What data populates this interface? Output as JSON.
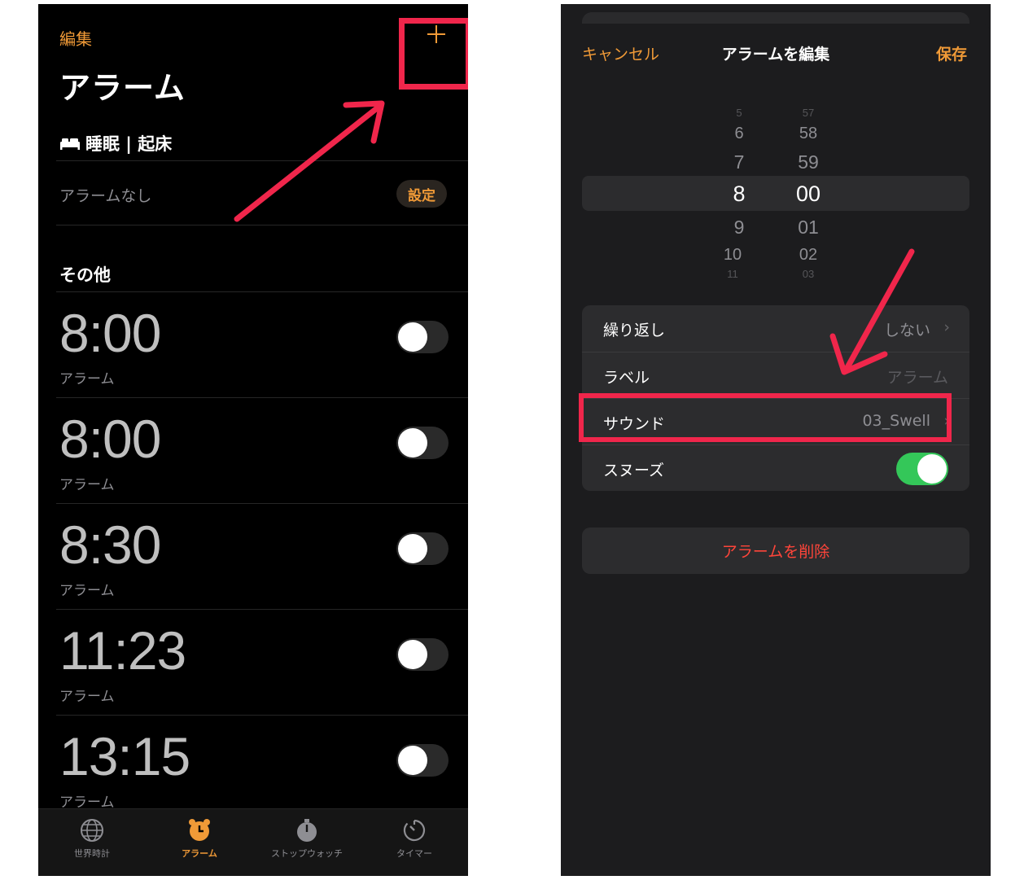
{
  "left": {
    "edit_label": "編集",
    "add_label": "+",
    "title": "アラーム",
    "sleep_header": "睡眠 | 起床",
    "no_alarm_label": "アラームなし",
    "set_button": "設定",
    "other_header": "その他",
    "alarms": [
      {
        "time": "8:00",
        "label": "アラーム",
        "enabled": false
      },
      {
        "time": "8:00",
        "label": "アラーム",
        "enabled": false
      },
      {
        "time": "8:30",
        "label": "アラーム",
        "enabled": false
      },
      {
        "time": "11:23",
        "label": "アラーム",
        "enabled": false
      },
      {
        "time": "13:15",
        "label": "アラーム",
        "enabled": false
      }
    ],
    "tabs": [
      {
        "label": "世界時計",
        "icon": "globe-icon",
        "active": false
      },
      {
        "label": "アラーム",
        "icon": "alarm-clock-icon",
        "active": true
      },
      {
        "label": "ストップウォッチ",
        "icon": "stopwatch-icon",
        "active": false
      },
      {
        "label": "タイマー",
        "icon": "timer-icon",
        "active": false
      }
    ]
  },
  "right": {
    "cancel_label": "キャンセル",
    "title": "アラームを編集",
    "save_label": "保存",
    "picker": {
      "hours": [
        "5",
        "6",
        "7",
        "8",
        "9",
        "10",
        "11"
      ],
      "minutes": [
        "57",
        "58",
        "59",
        "00",
        "01",
        "02",
        "03"
      ],
      "selected_hour": "8",
      "selected_minute": "00"
    },
    "settings": {
      "repeat_label": "繰り返し",
      "repeat_value": "しない",
      "label_label": "ラベル",
      "label_value": "アラーム",
      "sound_label": "サウンド",
      "sound_value": "03_Swell",
      "snooze_label": "スヌーズ",
      "snooze_enabled": true
    },
    "delete_label": "アラームを削除"
  },
  "colors": {
    "accent": "#f09a37",
    "highlight": "#f0264b",
    "toggle_on": "#34c759",
    "destructive": "#ff453a"
  }
}
